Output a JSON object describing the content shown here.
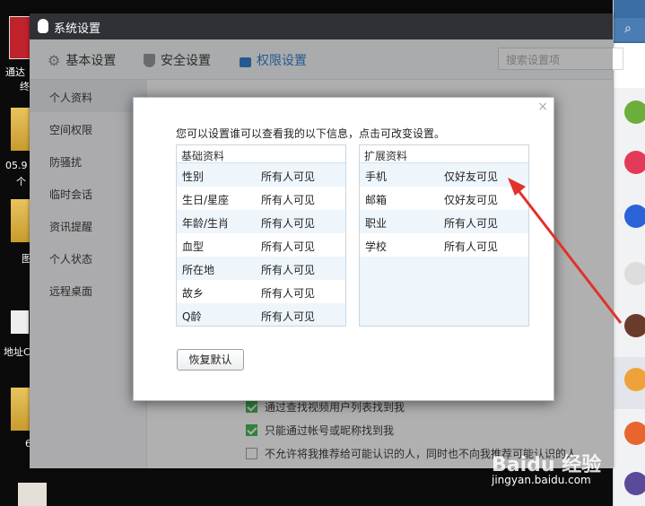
{
  "desktop": {
    "icons": [
      {
        "label": "通达",
        "label2": "终"
      },
      {
        "label": "05.9",
        "label2": "个"
      },
      {
        "label": "图"
      },
      {
        "label": "地址C"
      },
      {
        "label": "6"
      }
    ]
  },
  "window": {
    "title": "系统设置",
    "toolbar": {
      "basic": "基本设置",
      "security": "安全设置",
      "permission": "权限设置",
      "search_placeholder": "搜索设置项"
    },
    "sidebar": [
      "个人资料",
      "空间权限",
      "防骚扰",
      "临时会话",
      "资讯提醒",
      "个人状态",
      "远程桌面"
    ],
    "main_options": [
      {
        "text": "通过查找视频用户列表找到我",
        "checked": true
      },
      {
        "text": "只能通过帐号或昵称找到我",
        "checked": true
      },
      {
        "text": "不允许将我推荐给可能认识的人，同时也不向我推荐可能认识的人",
        "checked": false
      }
    ]
  },
  "dialog": {
    "hint": "您可以设置谁可以查看我的以下信息，点击可改变设置。",
    "basic_title": "基础资料",
    "basic_rows": [
      {
        "k": "性别",
        "v": "所有人可见"
      },
      {
        "k": "生日/星座",
        "v": "所有人可见"
      },
      {
        "k": "年龄/生肖",
        "v": "所有人可见"
      },
      {
        "k": "血型",
        "v": "所有人可见"
      },
      {
        "k": "所在地",
        "v": "所有人可见"
      },
      {
        "k": "故乡",
        "v": "所有人可见"
      },
      {
        "k": "Q龄",
        "v": "所有人可见"
      }
    ],
    "ext_title": "扩展资料",
    "ext_rows": [
      {
        "k": "手机",
        "v": "仅好友可见"
      },
      {
        "k": "邮箱",
        "v": "仅好友可见"
      },
      {
        "k": "职业",
        "v": "所有人可见"
      },
      {
        "k": "学校",
        "v": "所有人可见"
      }
    ],
    "restore_label": "恢复默认",
    "close_icon": "×"
  },
  "watermark": {
    "brand": "Baidu 经验",
    "url": "jingyan.baidu.com"
  },
  "colors": {
    "accent": "#2a7ad1",
    "titlebar": "#2f3136",
    "arrow": "#e0322b",
    "check": "#3bb84c"
  }
}
